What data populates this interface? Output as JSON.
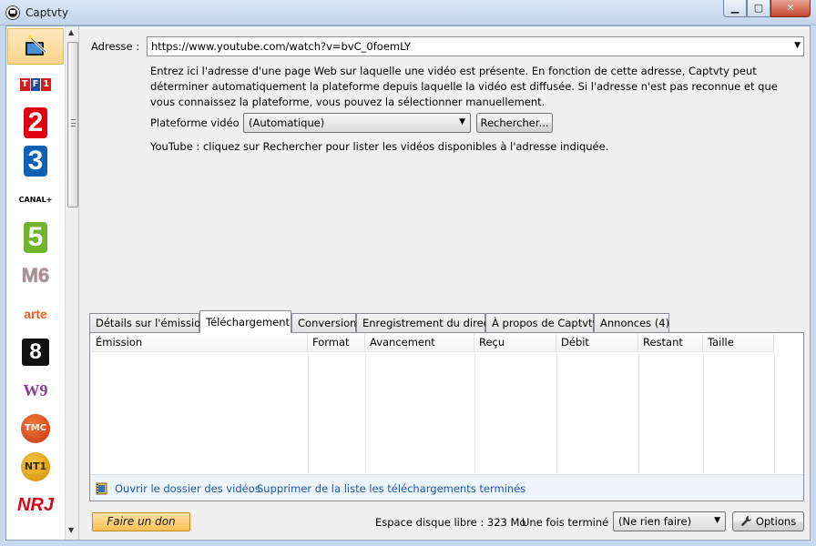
{
  "window": {
    "title": "Captvty",
    "minimize": "▁",
    "maximize": "▢",
    "close": "✕"
  },
  "channels": [
    {
      "id": "direct",
      "icon": "wand-icon"
    },
    {
      "id": "tf1",
      "letters": [
        "T",
        "F",
        "1"
      ],
      "colors": [
        "#d31c1c",
        "#1b4fa3",
        "#d31c1c"
      ]
    },
    {
      "id": "france2",
      "text": "2",
      "color": "#e1000f"
    },
    {
      "id": "france3",
      "text": "3",
      "color": "#0d62b5"
    },
    {
      "id": "canalplus",
      "text": "CANAL+"
    },
    {
      "id": "france5",
      "text": "5",
      "color": "#6fb42c"
    },
    {
      "id": "m6",
      "text": "M6"
    },
    {
      "id": "arte",
      "text": "arte"
    },
    {
      "id": "d8",
      "text": "8"
    },
    {
      "id": "w9",
      "text": "W9"
    },
    {
      "id": "tmc",
      "text": "TMC"
    },
    {
      "id": "nt1",
      "text": "NT1"
    },
    {
      "id": "nrj12",
      "text": "NRJ"
    }
  ],
  "address": {
    "label": "Adresse :",
    "value": "https://www.youtube.com/watch?v=bvC_0foemLY",
    "description": "Entrez ici l'adresse d'une page Web sur laquelle une vidéo est présente. En fonction de cette adresse, Captvty peut déterminer automatiquement la plateforme depuis laquelle la vidéo est diffusée. Si l'adresse n'est pas reconnue et que vous connaissez la plateforme, vous pouvez la sélectionner manuellement."
  },
  "platform": {
    "label": "Plateforme vidéo :",
    "selected": "(Automatique)",
    "search_button": "Rechercher...",
    "note": "YouTube : cliquez sur Rechercher pour lister les vidéos disponibles à l'adresse indiquée."
  },
  "tabs": [
    {
      "label": "Détails sur l'émission",
      "active": false
    },
    {
      "label": "Téléchargement",
      "active": true
    },
    {
      "label": "Conversion",
      "active": false
    },
    {
      "label": "Enregistrement du direct",
      "active": false
    },
    {
      "label": "À propos de Captvty",
      "active": false
    },
    {
      "label": "Annonces (4)",
      "active": false
    }
  ],
  "download_table": {
    "columns": [
      "Émission",
      "Format",
      "Avancement",
      "Reçu",
      "Débit",
      "Restant",
      "Taille"
    ],
    "rows": []
  },
  "panel_footer": {
    "open_folder_link": "Ouvrir le dossier des vidéos",
    "clear_link": "Supprimer de la liste les téléchargements terminés"
  },
  "bottom": {
    "donate_button": "Faire un don",
    "disk_space": "Espace disque libre : 323 Mo",
    "when_done_label": "Une fois terminé :",
    "when_done_selected": "(Ne rien faire)",
    "options_button": "Options"
  }
}
